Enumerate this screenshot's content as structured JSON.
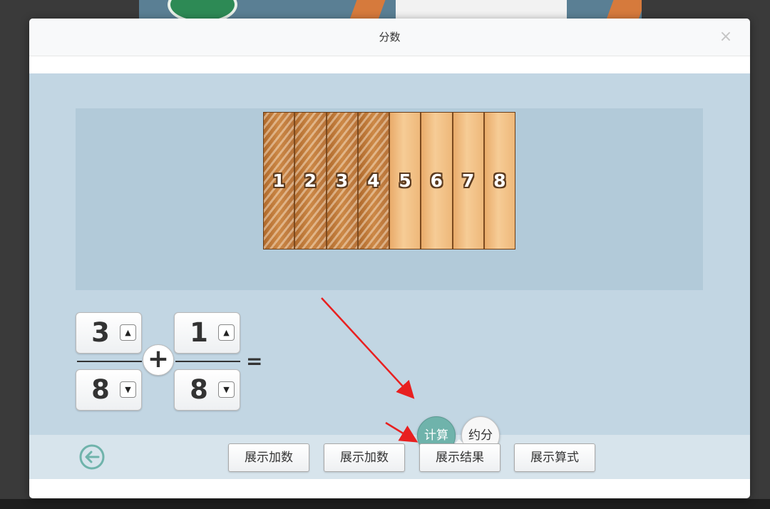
{
  "dialog": {
    "title": "分数",
    "close_label": "×"
  },
  "board": {
    "pieces": [
      {
        "label": "1",
        "shaded": true
      },
      {
        "label": "2",
        "shaded": true
      },
      {
        "label": "3",
        "shaded": true
      },
      {
        "label": "4",
        "shaded": true
      },
      {
        "label": "5",
        "shaded": false
      },
      {
        "label": "6",
        "shaded": false
      },
      {
        "label": "7",
        "shaded": false
      },
      {
        "label": "8",
        "shaded": false
      }
    ]
  },
  "equation": {
    "first": {
      "numerator": "3",
      "denominator": "8"
    },
    "operator": "+",
    "second": {
      "numerator": "1",
      "denominator": "8"
    },
    "equals": "="
  },
  "spinner": {
    "up": "▲",
    "down": "▼"
  },
  "actions": {
    "calculate": "计算",
    "reduce": "约分"
  },
  "footer": {
    "buttons": [
      "展示加数",
      "展示加数",
      "展示结果",
      "展示算式"
    ]
  },
  "colors": {
    "accent": "#6fb3ab",
    "wood_dark": "#b06a2c",
    "wood_light": "#f6cc96",
    "arrow": "#e82020"
  },
  "icons": {
    "back": "back-arrow-icon",
    "close": "close-icon"
  }
}
